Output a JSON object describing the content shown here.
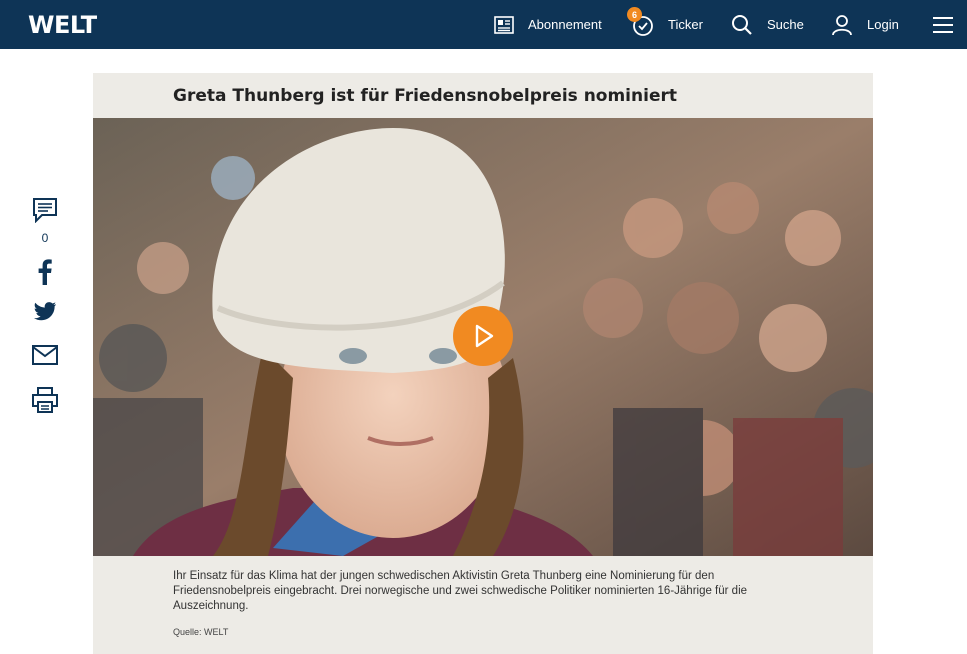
{
  "header": {
    "logo": "WELT",
    "nav": {
      "abonnement": "Abonnement",
      "ticker": "Ticker",
      "ticker_badge": "6",
      "suche": "Suche",
      "login": "Login"
    },
    "brand_color": "#0e3456",
    "accent_color": "#f18a21"
  },
  "share": {
    "comment_count": "0",
    "icons": [
      "comment-icon",
      "facebook-icon",
      "twitter-icon",
      "mail-icon",
      "print-icon"
    ]
  },
  "article": {
    "headline": "Greta Thunberg ist für Friedensnobelpreis nominiert",
    "caption": "Ihr Einsatz für das Klima hat der jungen schwedischen Aktivistin Greta Thunberg eine Nominierung für den Friedensnobelpreis eingebracht. Drei norwegische und zwei schwedische Politiker nominierten 16-Jährige für die Auszeichnung.",
    "source": "Quelle: WELT"
  }
}
